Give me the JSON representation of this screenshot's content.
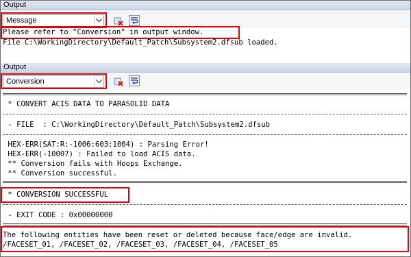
{
  "panel1": {
    "title": "Output",
    "selector_value": "Message",
    "lines": [
      "Please refer to \"Conversion\" in output window.",
      "File C:\\WorkingDirectory\\Default_Patch\\Subsystem2.dfsub loaded."
    ]
  },
  "panel2": {
    "title": "Output",
    "selector_value": "Conversion",
    "header_line": " * CONVERT ACIS DATA TO PARASOLID DATA",
    "file_line": " - FILE  : C:\\WorkingDirectory\\Default_Patch\\Subsystem2.dfsub",
    "log_lines": [
      " HEX-ERR(SAT:R:-1006:603:1004) : Parsing Error!",
      " HEX-ERR(-10007) : Failed to load ACIS data.",
      " ** Conversion fails with Hoops Exchange.",
      " ** Conversion successful."
    ],
    "status_line": " * CONVERSION SUCCESSFUL",
    "exit_line": " - EXIT CODE : 0x00000000",
    "footer_lines": [
      "The following entities have been reset or deleted because face/edge are invalid.",
      "/FACESET_01, /FACESET_02, /FACESET_03, /FACESET_04, /FACESET_05"
    ]
  },
  "icons": {
    "clear": "clear-output-icon",
    "wrap": "toggle-word-wrap-icon"
  },
  "colors": {
    "highlight": "#e0000f",
    "title_bar": "#cbd5e4"
  }
}
